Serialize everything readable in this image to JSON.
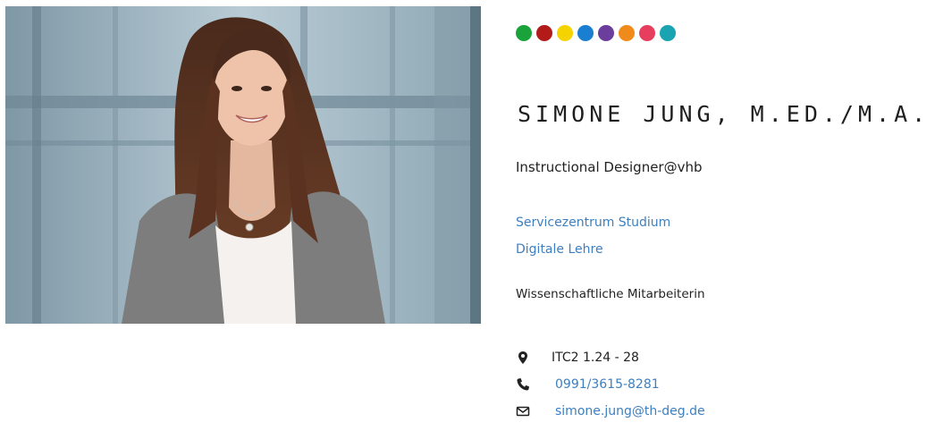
{
  "profile": {
    "name": "SIMONE JUNG, M.ED./M.A.",
    "role": "Instructional Designer@vhb",
    "units": [
      {
        "label": "Servicezentrum Studium"
      },
      {
        "label": "Digitale Lehre"
      }
    ],
    "position": "Wissenschaftliche Mitarbeiterin",
    "contact": {
      "room": "ITC2 1.24 - 28",
      "phone": "0991/3615-8281",
      "email": "simone.jung@th-deg.de"
    }
  },
  "color_dots": [
    "#1aa33a",
    "#b31b1b",
    "#f5d300",
    "#1a7fd0",
    "#6b3d9c",
    "#f08a1a",
    "#e63e5c",
    "#1aa3b0"
  ],
  "icons": {
    "room": "map-marker-icon",
    "phone": "phone-icon",
    "email": "envelope-icon"
  }
}
